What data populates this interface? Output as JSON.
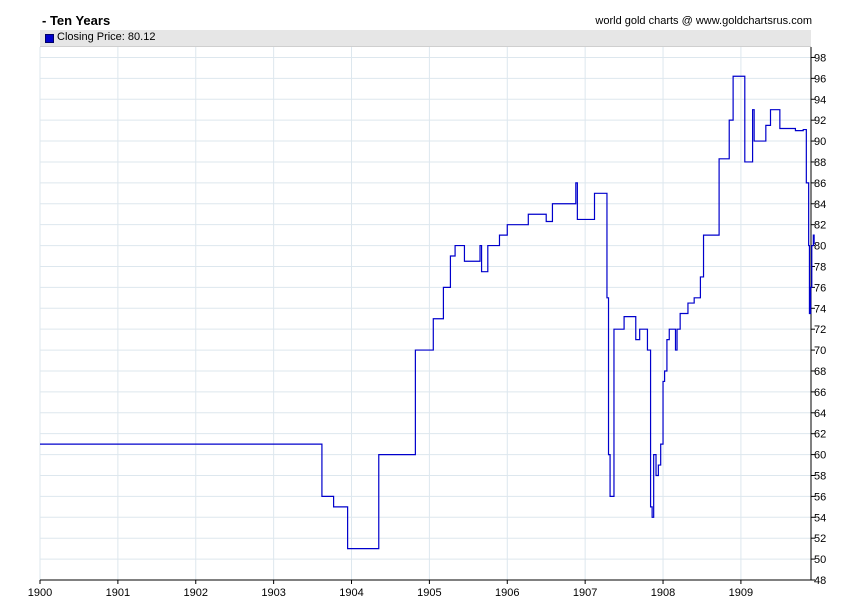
{
  "header": {
    "title": "- Ten Years",
    "source": "world gold charts @ www.goldchartsrus.com"
  },
  "legend": {
    "label": "Closing Price: 80.12"
  },
  "colors": {
    "line": "#0000cc",
    "grid": "#dde7ee",
    "legend_bg": "#e6e6e6"
  },
  "chart_data": {
    "type": "line",
    "title": "- Ten Years",
    "xlabel": "",
    "ylabel": "",
    "xlim": [
      1900,
      1909.9
    ],
    "ylim": [
      48,
      99
    ],
    "x_ticks": [
      "1900",
      "1901",
      "1902",
      "1903",
      "1904",
      "1905",
      "1906",
      "1907",
      "1908",
      "1909"
    ],
    "y_ticks": [
      48,
      50,
      52,
      54,
      56,
      58,
      60,
      62,
      64,
      66,
      68,
      70,
      72,
      74,
      76,
      78,
      80,
      82,
      84,
      86,
      88,
      90,
      92,
      94,
      96,
      98
    ],
    "grid": true,
    "legend_position": "top-left",
    "series": [
      {
        "name": "Closing Price",
        "step": true,
        "points": [
          [
            1900.0,
            61
          ],
          [
            1903.62,
            56
          ],
          [
            1903.77,
            55
          ],
          [
            1903.95,
            51
          ],
          [
            1904.35,
            60
          ],
          [
            1904.82,
            70
          ],
          [
            1905.05,
            73
          ],
          [
            1905.18,
            76
          ],
          [
            1905.27,
            79
          ],
          [
            1905.33,
            80
          ],
          [
            1905.45,
            78.5
          ],
          [
            1905.65,
            80
          ],
          [
            1905.67,
            77.5
          ],
          [
            1905.75,
            80
          ],
          [
            1905.9,
            81
          ],
          [
            1906.0,
            82
          ],
          [
            1906.27,
            83
          ],
          [
            1906.5,
            82.3
          ],
          [
            1906.58,
            84
          ],
          [
            1906.88,
            86
          ],
          [
            1906.9,
            82.5
          ],
          [
            1907.12,
            85
          ],
          [
            1907.28,
            75
          ],
          [
            1907.3,
            60
          ],
          [
            1907.32,
            56
          ],
          [
            1907.37,
            72
          ],
          [
            1907.5,
            73.2
          ],
          [
            1907.65,
            71
          ],
          [
            1907.7,
            72
          ],
          [
            1907.8,
            70
          ],
          [
            1907.84,
            55
          ],
          [
            1907.86,
            54
          ],
          [
            1907.88,
            60
          ],
          [
            1907.91,
            58
          ],
          [
            1907.94,
            59
          ],
          [
            1907.97,
            61
          ],
          [
            1908.0,
            67
          ],
          [
            1908.02,
            68
          ],
          [
            1908.05,
            71
          ],
          [
            1908.08,
            72
          ],
          [
            1908.16,
            70
          ],
          [
            1908.18,
            72
          ],
          [
            1908.22,
            73.5
          ],
          [
            1908.32,
            74.5
          ],
          [
            1908.4,
            75
          ],
          [
            1908.48,
            77
          ],
          [
            1908.52,
            81
          ],
          [
            1908.72,
            88.3
          ],
          [
            1908.85,
            92
          ],
          [
            1908.9,
            96.2
          ],
          [
            1909.05,
            88
          ],
          [
            1909.15,
            93
          ],
          [
            1909.17,
            90
          ],
          [
            1909.32,
            91.5
          ],
          [
            1909.38,
            93
          ],
          [
            1909.5,
            91.2
          ],
          [
            1909.7,
            91
          ],
          [
            1909.8,
            91.1
          ],
          [
            1909.84,
            86
          ],
          [
            1909.87,
            80
          ],
          [
            1909.88,
            73.5
          ],
          [
            1909.895,
            76
          ],
          [
            1909.91,
            80
          ],
          [
            1909.93,
            81
          ],
          [
            1909.94,
            80.12
          ]
        ]
      }
    ]
  }
}
